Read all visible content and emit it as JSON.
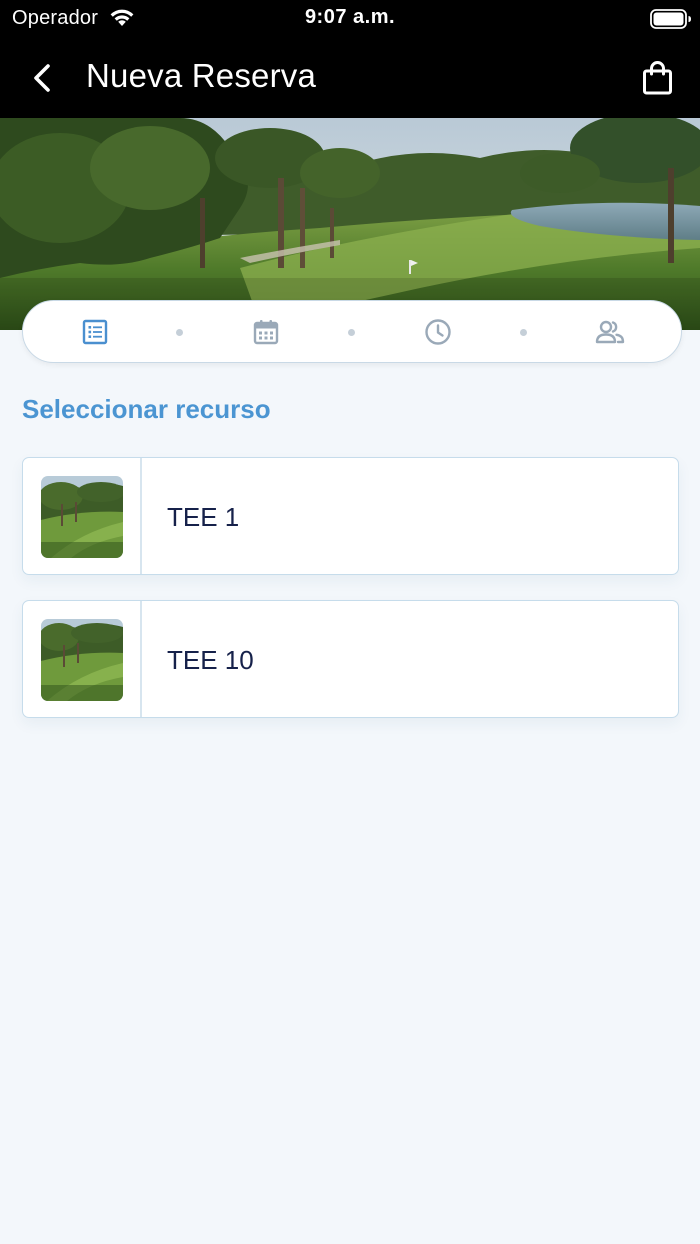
{
  "status_bar": {
    "carrier": "Operador",
    "time": "9:07 a.m."
  },
  "nav": {
    "title": "Nueva Reserva"
  },
  "stepper": {
    "steps": [
      {
        "icon": "list-icon",
        "active": true
      },
      {
        "icon": "calendar-icon",
        "active": false
      },
      {
        "icon": "clock-icon",
        "active": false
      },
      {
        "icon": "people-icon",
        "active": false
      }
    ]
  },
  "main": {
    "section_title": "Seleccionar recurso",
    "resources": [
      {
        "name": "TEE 1",
        "thumb": "golf-course-thumbnail"
      },
      {
        "name": "TEE 10",
        "thumb": "golf-course-thumbnail"
      }
    ]
  },
  "colors": {
    "accent": "#4b95d2",
    "active_step": "#4a8fcf",
    "inactive_step": "#9aa9b8",
    "resource_text": "#16214a",
    "background": "#f3f7fb"
  }
}
